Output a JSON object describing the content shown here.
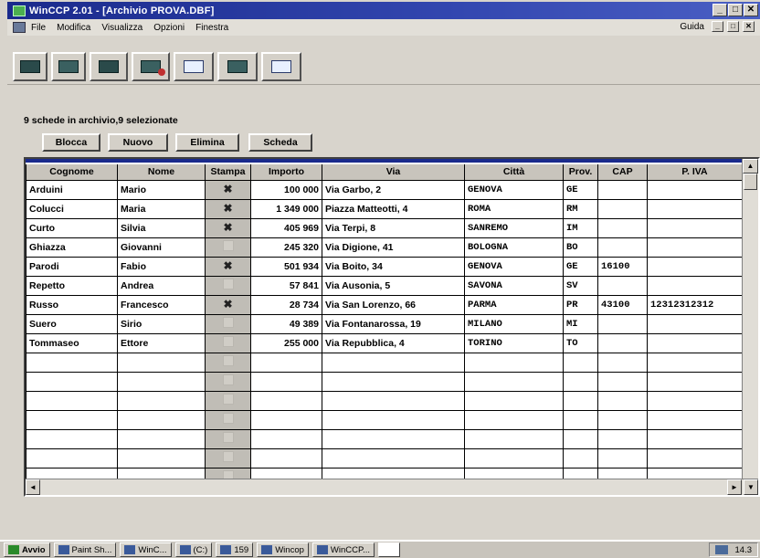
{
  "window": {
    "title": "WinCCP 2.01 - [Archivio PROVA.DBF]",
    "controls": [
      "_",
      "□",
      "✕"
    ]
  },
  "menu": {
    "items": [
      "File",
      "Modifica",
      "Visualizza",
      "Opzioni",
      "Finestra"
    ],
    "help": "Guida",
    "doc_controls": [
      "_",
      "□",
      "✕"
    ]
  },
  "toolbar": {
    "buttons": [
      "card-icon",
      "grid-icon",
      "card-edit-icon",
      "card-delete-icon",
      "sheet-print-icon",
      "save-icon",
      "play-icon"
    ]
  },
  "status": {
    "records": "9 schede in archivio,9 selezionate"
  },
  "actions": {
    "blocca": "Blocca",
    "nuovo": "Nuovo",
    "elimina": "Elimina",
    "scheda": "Scheda"
  },
  "table": {
    "columns": [
      "Cognome",
      "Nome",
      "Stampa",
      "Importo",
      "Via",
      "Città",
      "Prov.",
      "CAP",
      "P. IVA"
    ],
    "rows": [
      {
        "cognome": "Arduini",
        "nome": "Mario",
        "stampa": true,
        "importo": "100 000",
        "via": "Via Garbo, 2",
        "citta": "GENOVA",
        "prov": "GE",
        "cap": "",
        "piva": ""
      },
      {
        "cognome": "Colucci",
        "nome": "Maria",
        "stampa": true,
        "importo": "1 349 000",
        "via": "Piazza Matteotti, 4",
        "citta": "ROMA",
        "prov": "RM",
        "cap": "",
        "piva": ""
      },
      {
        "cognome": "Curto",
        "nome": "Silvia",
        "stampa": true,
        "importo": "405 969",
        "via": "Via Terpi, 8",
        "citta": "SANREMO",
        "prov": "IM",
        "cap": "",
        "piva": ""
      },
      {
        "cognome": "Ghiazza",
        "nome": "Giovanni",
        "stampa": false,
        "importo": "245 320",
        "via": "Via Digione, 41",
        "citta": "BOLOGNA",
        "prov": "BO",
        "cap": "",
        "piva": ""
      },
      {
        "cognome": "Parodi",
        "nome": "Fabio",
        "stampa": true,
        "importo": "501 934",
        "via": "Via Boito, 34",
        "citta": "GENOVA",
        "prov": "GE",
        "cap": "16100",
        "piva": ""
      },
      {
        "cognome": "Repetto",
        "nome": "Andrea",
        "stampa": false,
        "importo": "57 841",
        "via": "Via Ausonia, 5",
        "citta": "SAVONA",
        "prov": "SV",
        "cap": "",
        "piva": ""
      },
      {
        "cognome": "Russo",
        "nome": "Francesco",
        "stampa": true,
        "importo": "28 734",
        "via": "Via San Lorenzo, 66",
        "citta": "PARMA",
        "prov": "PR",
        "cap": "43100",
        "piva": "12312312312"
      },
      {
        "cognome": "Suero",
        "nome": "Sirio",
        "stampa": false,
        "importo": "49 389",
        "via": "Via Fontanarossa, 19",
        "citta": "MILANO",
        "prov": "MI",
        "cap": "",
        "piva": ""
      },
      {
        "cognome": "Tommaseo",
        "nome": "Ettore",
        "stampa": false,
        "importo": "255 000",
        "via": "Via Repubblica, 4",
        "citta": "TORINO",
        "prov": "TO",
        "cap": "",
        "piva": ""
      }
    ],
    "check_glyph": "✖"
  },
  "scrollbars": {
    "up": "▲",
    "left": "◄",
    "right": "►",
    "down": "▼"
  },
  "taskbar": {
    "start": "Avvio",
    "tasks": [
      "Paint Sh...",
      "WinC...",
      "(C:)",
      "159",
      "Wincop",
      "WinCCP..."
    ],
    "clock": "14.3"
  }
}
